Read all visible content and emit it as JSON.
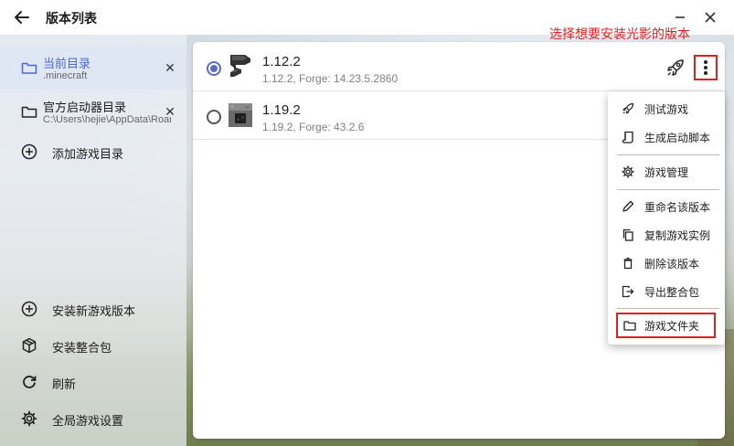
{
  "window": {
    "title": "版本列表"
  },
  "sidebar": {
    "dirs": [
      {
        "label": "当前目录",
        "path": ".minecraft"
      },
      {
        "label": "官方启动器目录",
        "path": "C:\\Users\\hejie\\AppData\\Roaming\\.minecraft"
      }
    ],
    "add_dir_label": "添加游戏目录",
    "bottom": [
      {
        "label": "安装新游戏版本"
      },
      {
        "label": "安装整合包"
      },
      {
        "label": "刷新"
      },
      {
        "label": "全局游戏设置"
      }
    ]
  },
  "versions": [
    {
      "name": "1.12.2",
      "desc": "1.12.2, Forge: 14.23.5.2860",
      "selected": true
    },
    {
      "name": "1.19.2",
      "desc": "1.19.2, Forge: 43.2.6",
      "selected": false
    }
  ],
  "annotation": "选择想要安装光影的版本",
  "menu": {
    "items": [
      {
        "label": "测试游戏"
      },
      {
        "label": "生成启动脚本"
      },
      {
        "label": "游戏管理"
      },
      {
        "label": "重命名该版本"
      },
      {
        "label": "复制游戏实例"
      },
      {
        "label": "删除该版本"
      },
      {
        "label": "导出整合包"
      },
      {
        "label": "游戏文件夹"
      }
    ]
  },
  "colors": {
    "accent": "#5c6bc0",
    "annotation": "#e02020"
  }
}
